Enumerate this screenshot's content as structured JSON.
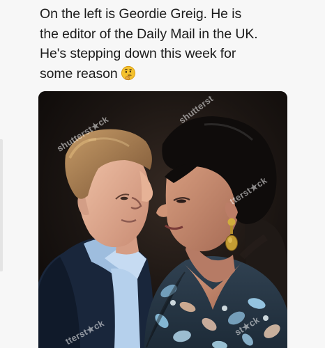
{
  "post": {
    "caption_lines": [
      "On the left is Geordie Greig. He is",
      "the editor of the Daily Mail in the UK.",
      "He's stepping down this week for",
      "some reason"
    ],
    "emoji": "thinking-face"
  },
  "photo": {
    "watermarks": [
      "shutterst★ck",
      "shutterst",
      "tterst★ck",
      "tterst★ck",
      "st★ck"
    ]
  }
}
